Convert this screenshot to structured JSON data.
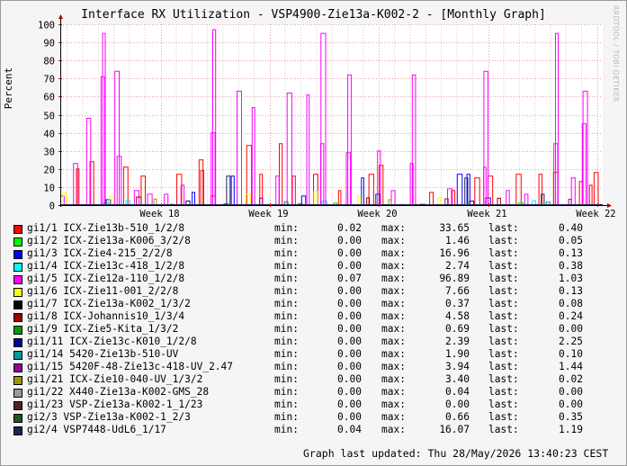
{
  "chart_data": {
    "type": "line",
    "title": "Interface RX Utilization - VSP4900-Zie13a-K002-2 - [Monthly Graph]",
    "ylabel": "Percent",
    "xlabel": "",
    "ylim": [
      0,
      100
    ],
    "yticks": [
      0,
      10,
      20,
      30,
      40,
      50,
      60,
      70,
      80,
      90,
      100
    ],
    "xlim": [
      17.08,
      22.05
    ],
    "xticks": [
      {
        "x": 18,
        "label": "Week 18"
      },
      {
        "x": 19,
        "label": "Week 19"
      },
      {
        "x": 20,
        "label": "Week 20"
      },
      {
        "x": 21,
        "label": "Week 21"
      },
      {
        "x": 22,
        "label": "Week 22"
      }
    ],
    "grid": true,
    "series": [
      {
        "name": "gi1/1 ICX-Zie13b-510_1/2/8",
        "color": "#ff0000",
        "min": "0.02",
        "max": "33.65",
        "last": "0.40",
        "peaks": [
          [
            17.24,
            20
          ],
          [
            17.37,
            24
          ],
          [
            17.68,
            21
          ],
          [
            17.84,
            16
          ],
          [
            18.17,
            17
          ],
          [
            18.37,
            25
          ],
          [
            18.38,
            19
          ],
          [
            18.48,
            5
          ],
          [
            18.81,
            33
          ],
          [
            18.92,
            17
          ],
          [
            19.1,
            34
          ],
          [
            19.22,
            16
          ],
          [
            19.42,
            17
          ],
          [
            19.64,
            8
          ],
          [
            19.93,
            17
          ],
          [
            20.02,
            22
          ],
          [
            20.48,
            7
          ],
          [
            20.68,
            8
          ],
          [
            20.9,
            15
          ],
          [
            21.02,
            16
          ],
          [
            21.28,
            17
          ],
          [
            21.48,
            17
          ],
          [
            21.62,
            18
          ],
          [
            21.85,
            13
          ],
          [
            21.94,
            11
          ],
          [
            21.99,
            18
          ]
        ]
      },
      {
        "name": "gi1/2 ICX-Zie13a-K006_3/2/8",
        "color": "#00ff00",
        "min": "0.00",
        "max": "1.46",
        "last": "0.05",
        "peaks": [
          [
            17.5,
            1.4
          ],
          [
            19.6,
            1.2
          ],
          [
            21.3,
            1.3
          ]
        ]
      },
      {
        "name": "gi1/3 ICX-Zie4-215_2/2/8",
        "color": "#0000ff",
        "min": "0.00",
        "max": "16.96",
        "last": "0.13",
        "peaks": [
          [
            17.52,
            3
          ],
          [
            18.3,
            7
          ],
          [
            18.66,
            16
          ],
          [
            19.31,
            5
          ],
          [
            19.85,
            15
          ],
          [
            19.99,
            6
          ],
          [
            20.74,
            17
          ],
          [
            20.82,
            17
          ],
          [
            21.0,
            4
          ]
        ]
      },
      {
        "name": "gi1/4 ICX-Zie13c-418_1/2/8",
        "color": "#00ffff",
        "min": "0.00",
        "max": "2.74",
        "last": "0.38",
        "peaks": [
          [
            17.7,
            2.7
          ],
          [
            19.5,
            2.2
          ],
          [
            21.42,
            2.5
          ]
        ]
      },
      {
        "name": "gi1/5 ICX-Zie12a-110_1/2/8",
        "color": "#ff00ff",
        "min": "0.07",
        "max": "96.89",
        "last": "1.03",
        "peaks": [
          [
            17.1,
            5
          ],
          [
            17.22,
            23
          ],
          [
            17.34,
            48
          ],
          [
            17.47,
            71
          ],
          [
            17.48,
            95
          ],
          [
            17.6,
            74
          ],
          [
            17.62,
            27
          ],
          [
            17.78,
            8
          ],
          [
            17.9,
            6
          ],
          [
            18.05,
            6
          ],
          [
            18.2,
            11
          ],
          [
            18.48,
            40
          ],
          [
            18.49,
            97
          ],
          [
            18.72,
            63
          ],
          [
            18.85,
            54
          ],
          [
            19.07,
            16
          ],
          [
            19.18,
            62
          ],
          [
            19.35,
            61
          ],
          [
            19.48,
            34
          ],
          [
            19.49,
            95
          ],
          [
            19.72,
            29
          ],
          [
            19.73,
            72
          ],
          [
            20.0,
            30
          ],
          [
            20.13,
            8
          ],
          [
            20.3,
            23
          ],
          [
            20.32,
            72
          ],
          [
            20.65,
            9
          ],
          [
            20.97,
            21
          ],
          [
            20.98,
            74
          ],
          [
            21.18,
            8
          ],
          [
            21.35,
            6
          ],
          [
            21.62,
            34
          ],
          [
            21.63,
            95
          ],
          [
            21.78,
            15
          ],
          [
            21.88,
            45
          ],
          [
            21.89,
            63
          ]
        ]
      },
      {
        "name": "gi1/6 ICX-Zie11-001_2/2/8",
        "color": "#ffff00",
        "min": "0.00",
        "max": "7.66",
        "last": "0.13",
        "peaks": [
          [
            17.12,
            7
          ],
          [
            17.55,
            5
          ],
          [
            18.8,
            6
          ],
          [
            19.42,
            7.6
          ],
          [
            19.82,
            5
          ],
          [
            20.55,
            4
          ]
        ]
      },
      {
        "name": "gi1/7 ICX-Zie13a-K002_1/3/2",
        "color": "#000000",
        "min": "0.00",
        "max": "0.37",
        "last": "0.08",
        "peaks": [
          [
            18.1,
            0.37
          ],
          [
            20.2,
            0.3
          ]
        ]
      },
      {
        "name": "gi1/8 ICX-Johannis10_1/3/4",
        "color": "#990000",
        "min": "0.00",
        "max": "4.58",
        "last": "0.24",
        "peaks": [
          [
            17.8,
            4.5
          ],
          [
            19.9,
            4
          ],
          [
            21.1,
            3.8
          ]
        ]
      },
      {
        "name": "gi1/9 ICX-Zie5-Kita_1/3/2",
        "color": "#009900",
        "min": "0.00",
        "max": "0.69",
        "last": "0.00",
        "peaks": [
          [
            18.6,
            0.69
          ],
          [
            20.4,
            0.5
          ]
        ]
      },
      {
        "name": "gi1/11 ICX-Zie13c-K010_1/2/8",
        "color": "#000099",
        "min": "0.00",
        "max": "2.39",
        "last": "2.25",
        "peaks": [
          [
            18.25,
            2.3
          ],
          [
            20.85,
            2.2
          ]
        ]
      },
      {
        "name": "gi1/14 5420-Zie13b-510-UV",
        "color": "#009999",
        "min": "0.00",
        "max": "1.90",
        "last": "0.10",
        "peaks": [
          [
            19.15,
            1.9
          ],
          [
            21.55,
            1.6
          ]
        ]
      },
      {
        "name": "gi1/15 5420F-48-Zie13c-418-UV_2.47",
        "color": "#990099",
        "min": "0.00",
        "max": "3.94",
        "last": "1.44",
        "peaks": [
          [
            18.92,
            3.9
          ],
          [
            20.62,
            3.5
          ],
          [
            21.75,
            3.2
          ]
        ]
      },
      {
        "name": "gi1/21 ICX-Zie10-040-UV_1/3/2",
        "color": "#999900",
        "min": "0.00",
        "max": "3.40",
        "last": "0.02",
        "peaks": [
          [
            17.95,
            3.4
          ],
          [
            20.1,
            3
          ]
        ]
      },
      {
        "name": "gi1/22 X440-Zie13a-K002-GMS_28",
        "color": "#999999",
        "min": "0.00",
        "max": "0.04",
        "last": "0.00",
        "peaks": []
      },
      {
        "name": "gi1/23 VSP-Zie13a-K002-1_1/23",
        "color": "#552222",
        "min": "0.00",
        "max": "0.00",
        "last": "0.00",
        "peaks": []
      },
      {
        "name": "gi2/3 VSP-Zie13a-K002-1_2/3",
        "color": "#225522",
        "min": "0.00",
        "max": "0.66",
        "last": "0.35",
        "peaks": [
          [
            19.28,
            0.66
          ]
        ]
      },
      {
        "name": "gi2/4 VSP7448-UdL6_1/17",
        "color": "#222255",
        "min": "0.04",
        "max": "16.07",
        "last": "1.19",
        "peaks": [
          [
            18.62,
            16
          ],
          [
            20.8,
            15
          ],
          [
            21.5,
            6
          ]
        ]
      }
    ]
  },
  "labels": {
    "min": "min:",
    "max": "max:",
    "last": "last:"
  },
  "watermark": "RRDTOOL / TOBI OETIKER",
  "updated": "Graph last updated: Thu 28/May/2026 13:40:23 CEST"
}
